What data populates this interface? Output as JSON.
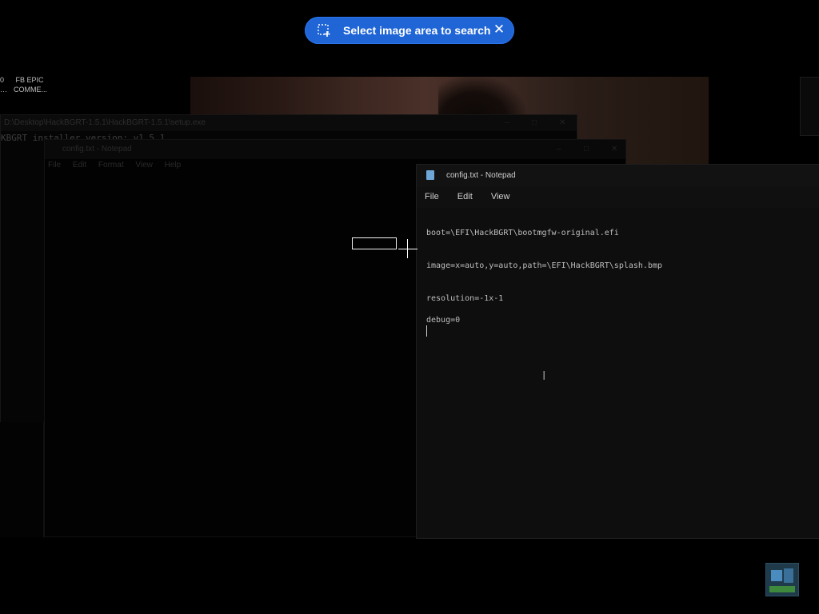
{
  "search_overlay": {
    "label": "Select image area to search",
    "close_glyph": "✕",
    "icon": "select-area-icon",
    "accent": "#1f65d6"
  },
  "desktop": {
    "icon_labels": [
      {
        "line1": "0",
        "line2": "…"
      },
      {
        "line1": "FB EPIC",
        "line2": "COMME..."
      }
    ]
  },
  "background_cmd": {
    "title": "D:\\Desktop\\HackBGRT-1.5.1\\HackBGRT-1.5.1\\setup.exe",
    "text": "KBGRT installer version: v1.5.1"
  },
  "background_notepad": {
    "title": "config.txt - Notepad",
    "menu": [
      "File",
      "Edit",
      "Format",
      "View",
      "Help"
    ]
  },
  "notepad": {
    "title": "config.txt - Notepad",
    "menu": [
      "File",
      "Edit",
      "View"
    ],
    "lines": [
      "boot=\\EFI\\HackBGRT\\bootmgfw-original.efi",
      "image=x=auto,y=auto,path=\\EFI\\HackBGRT\\splash.bmp",
      "resolution=-1x-1",
      "debug=0"
    ]
  }
}
